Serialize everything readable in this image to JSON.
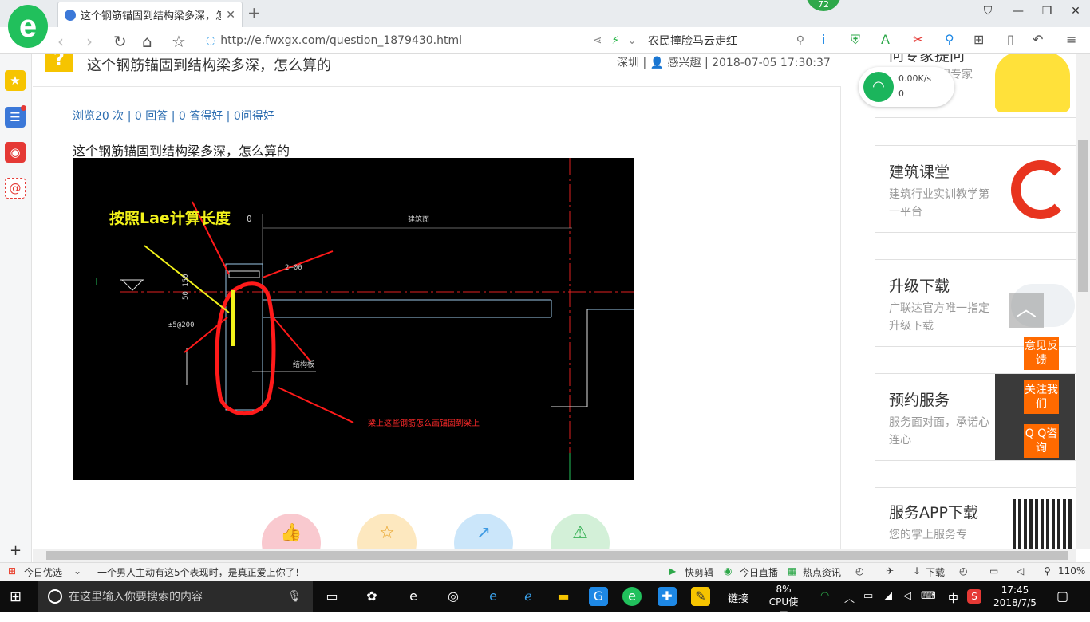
{
  "browser": {
    "logo_glyph": "e",
    "tab_title": "这个钢筋锚固到结构梁多深，怎么",
    "tab_close": "✕",
    "new_tab": "+",
    "badge_count": "72",
    "url": "http://e.fwxgx.com/question_1879430.html",
    "hot_search": "农民撞脸马云走红",
    "window_buttons": [
      "⛉",
      "—",
      "❐",
      "✕"
    ]
  },
  "network_widget": {
    "speed": "0.00K/s",
    "count": "0"
  },
  "question": {
    "title": "这个钢筋锚固到结构梁多深，怎么算的",
    "meta": "深圳 | 👤 感兴趣 | 2018-07-05 17:30:37",
    "stats": "浏览20 次 | 0 回答 | 0 答得好 | 0问得好",
    "body": "这个钢筋锚固到结构梁多深，怎么算的"
  },
  "cad": {
    "annotation_yellow": "按照Lae计算长度",
    "annotation_red": "梁上这些钢筋怎么画锚固到梁上",
    "label_dim": "2–00",
    "label_rebar": "±5@200",
    "label_side": "结构板",
    "label_top": "建筑面",
    "label_left": "50 150",
    "label_zero": "0"
  },
  "reactions": [
    {
      "icon": "👍",
      "color": "#f9c9cf",
      "fg": "#e5596a"
    },
    {
      "icon": "☆",
      "color": "#fde8bf",
      "fg": "#e8a020"
    },
    {
      "icon": "↗",
      "color": "#cbe6fa",
      "fg": "#3f9be3"
    },
    {
      "icon": "⚠",
      "color": "#d3f0d8",
      "fg": "#3cb35a"
    }
  ],
  "sidebar_cards": [
    {
      "title": "问专家提问",
      "desc": "问专家"
    },
    {
      "title": "建筑课堂",
      "desc": "建筑行业实训教学第一平台"
    },
    {
      "title": "升级下载",
      "desc": "广联达官方唯一指定升级下载"
    },
    {
      "title": "预约服务",
      "desc": "服务面对面，承诺心连心"
    },
    {
      "title": "服务APP下载",
      "desc": "您的掌上服务专"
    }
  ],
  "float_buttons": [
    "意见反馈",
    "关注我们",
    "Q Q咨询"
  ],
  "statusbar": {
    "news_source": "今日优选",
    "headline": "一个男人主动有这5个表现时，是真正爱上你了！",
    "quick_edit": "快剪辑",
    "live": "今日直播",
    "hot_info": "热点资讯",
    "download": "下载",
    "zoom": "110%"
  },
  "taskbar": {
    "search_placeholder": "在这里输入你要搜索的内容",
    "link_label": "链接",
    "cpu_percent": "8%",
    "cpu_label": "CPU使用",
    "ime": "中",
    "time": "17:45",
    "date": "2018/7/5"
  }
}
